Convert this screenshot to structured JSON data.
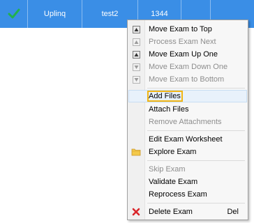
{
  "grid": {
    "row": {
      "status_icon": "check-icon",
      "cells": [
        "Uplinq",
        "test2",
        "1344",
        "",
        ""
      ]
    },
    "colors": {
      "row_bg": "#3a8ee6",
      "check": "#22b14c"
    }
  },
  "menu": {
    "items": [
      {
        "label": "Move Exam to Top",
        "icon": "move-to-top-icon",
        "disabled": false
      },
      {
        "label": "Process Exam Next",
        "icon": "process-next-icon",
        "disabled": true
      },
      {
        "label": "Move Exam Up One",
        "icon": "move-up-icon",
        "disabled": false
      },
      {
        "label": "Move Exam Down One",
        "icon": "move-down-icon",
        "disabled": true
      },
      {
        "label": "Move Exam to Bottom",
        "icon": "move-to-bottom-icon",
        "disabled": true
      },
      {
        "label": "Add Files",
        "icon": "",
        "disabled": false
      },
      {
        "label": "Attach Files",
        "icon": "",
        "disabled": false
      },
      {
        "label": "Remove Attachments",
        "icon": "",
        "disabled": true
      },
      {
        "label": "Edit Exam Worksheet",
        "icon": "",
        "disabled": false
      },
      {
        "label": "Explore Exam",
        "icon": "folder-icon",
        "disabled": false
      },
      {
        "label": "Skip Exam",
        "icon": "",
        "disabled": true
      },
      {
        "label": "Validate Exam",
        "icon": "",
        "disabled": false
      },
      {
        "label": "Reprocess Exam",
        "icon": "",
        "disabled": false
      },
      {
        "label": "Delete Exam",
        "icon": "delete-x-icon",
        "disabled": false,
        "shortcut": "Del"
      }
    ],
    "highlight_color": "#f1b514"
  }
}
